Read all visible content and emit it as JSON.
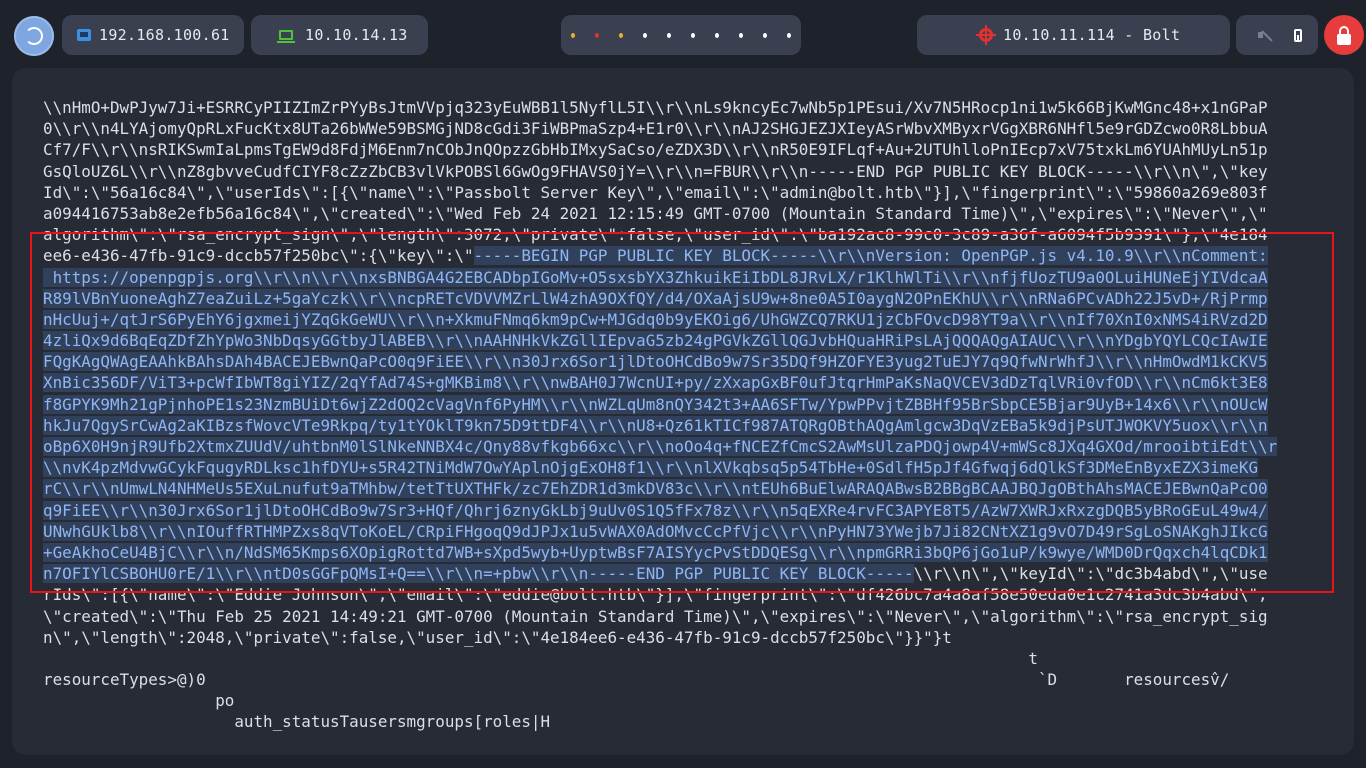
{
  "topbar": {
    "network_ip": "192.168.100.61",
    "vpn_ip": "10.10.14.13",
    "target": "10.10.11.114 - Bolt",
    "workspace_dot_colors": [
      "#e8b030",
      "#e63030",
      "#e8b030",
      "#ffffff",
      "#ffffff",
      "#ffffff",
      "#ffffff",
      "#ffffff",
      "#ffffff",
      "#ffffff"
    ],
    "icons": {
      "logo": "debian-swirl-icon",
      "network": "network-card-icon",
      "vpn": "laptop-icon",
      "target": "crosshair-icon",
      "mute": "speaker-muted-icon",
      "battery": "battery-icon",
      "lock": "lock-icon"
    }
  },
  "terminal": {
    "lines": [
      {
        "pre": "\\\\nHmO+DwPJyw7Ji+ESRRCyPIIZImZrPYyBsJtmVVpjq323yEuWBB1l5NyflL5I\\\\r\\\\nLs9kncyEc7wNb5p1PEsui/Xv7N5HRocp1ni1w5k66BjKwMGnc48+x1nGPaP",
        "sel": "",
        "post": ""
      },
      {
        "pre": "0\\\\r\\\\n4LYAjomyQpRLxFucKtx8UTa26bWWe59BSMGjND8cGdi3FiWBPmaSzp4+E1r0\\\\r\\\\nAJ2SHGJEZJXIeyASrWbvXMByxrVGgXBR6NHfl5e9rGDZcwo0R8LbbuA",
        "sel": "",
        "post": ""
      },
      {
        "pre": "Cf7/F\\\\r\\\\nsRIKSwmIaLpmsTgEW9d8FdjM6Enm7nCObJnQOpzzGbHbIMxySaCso/eZDX3D\\\\r\\\\nR50E9IFLqf+Au+2UTUhlloPnIEcp7xV75txkLm6YUAhMUyLn51p",
        "sel": "",
        "post": ""
      },
      {
        "pre": "GsQloUZ6L\\\\r\\\\nZ8gbvveCudfCIYF8cZzZbCB3vlVkPOBSl6GwOg9FHAVS0jY=\\\\r\\\\n=FBUR\\\\r\\\\n-----END PGP PUBLIC KEY BLOCK-----\\\\r\\\\n\\\",\\\"key",
        "sel": "",
        "post": ""
      },
      {
        "pre": "Id\\\":\\\"56a16c84\\\",\\\"userIds\\\":[{\\\"name\\\":\\\"Passbolt Server Key\\\",\\\"email\\\":\\\"admin@bolt.htb\\\"}],\\\"fingerprint\\\":\\\"59860a269e803f",
        "sel": "",
        "post": ""
      },
      {
        "pre": "a094416753ab8e2efb56a16c84\\\",\\\"created\\\":\\\"Wed Feb 24 2021 12:15:49 GMT-0700 (Mountain Standard Time)\\\",\\\"expires\\\":\\\"Never\\\",\\\"",
        "sel": "",
        "post": ""
      },
      {
        "pre": "algorithm\\\":\\\"rsa_encrypt_sign\\\",\\\"length\\\":3072,\\\"private\\\":false,\\\"user_id\\\":\\\"ba192ac8-99c0-3c89-a36f-a6094f5b9391\\\"},\\\"4e184",
        "sel": "",
        "post": ""
      },
      {
        "pre": "ee6-e436-47fb-91c9-dccb57f250bc\\\":{\\\"key\\\":\\\"",
        "sel": "-----BEGIN PGP PUBLIC KEY BLOCK-----\\\\r\\\\nVersion: OpenPGP.js v4.10.9\\\\r\\\\nComment:",
        "post": ""
      },
      {
        "pre": "",
        "sel": " https://openpgpjs.org\\\\r\\\\n\\\\r\\\\nxsBNBGA4G2EBCADbpIGoMv+O5sxsbYX3ZhkuikEiIbDL8JRvLX/r1KlhWlTi\\\\r\\\\nfjfUozTU9a0OLuiHUNeEjYIVdcaA",
        "post": ""
      },
      {
        "pre": "",
        "sel": "R89lVBnYuoneAghZ7eaZuiLz+5gaYczk\\\\r\\\\ncpRETcVDVVMZrLlW4zhA9OXfQY/d4/OXaAjsU9w+8ne0A5I0aygN2OPnEKhU\\\\r\\\\nRNa6PCvADh22J5vD+/RjPrmp",
        "post": ""
      },
      {
        "pre": "",
        "sel": "nHcUuj+/qtJrS6PyEhY6jgxmeijYZqGkGeWU\\\\r\\\\n+XkmuFNmq6km9pCw+MJGdq0b9yEKOig6/UhGWZCQ7RKU1jzCbFOvcD98YT9a\\\\r\\\\nIf70XnI0xNMS4iRVzd2D",
        "post": ""
      },
      {
        "pre": "",
        "sel": "4zliQx9d6BqEqZDfZhYpWo3NbDqsyGGtbyJlABEB\\\\r\\\\nAAHNHkVkZGllIEpvaG5zb24gPGVkZGllQGJvbHQuaHRiPsLAjQQQAQgAIAUC\\\\r\\\\nYDgbYQYLCQcIAwIE",
        "post": ""
      },
      {
        "pre": "",
        "sel": "FQgKAgQWAgEAAhkBAhsDAh4BACEJEBwnQaPcO0q9FiEE\\\\r\\\\n30Jrx6Sor1jlDtoOHCdBo9w7Sr35DQf9HZOFYE3yug2TuEJY7q9QfwNrWhfJ\\\\r\\\\nHmOwdM1kCKV5",
        "post": ""
      },
      {
        "pre": "",
        "sel": "XnBic356DF/ViT3+pcWfIbWT8giYIZ/2qYfAd74S+gMKBim8\\\\r\\\\nwBAH0J7WcnUI+py/zXxapGxBF0ufJtqrHmPaKsNaQVCEV3dDzTqlVRi0vfOD\\\\r\\\\nCm6kt3E8",
        "post": ""
      },
      {
        "pre": "",
        "sel": "f8GPYK9Mh21gPjnhoPE1s23NzmBUiDt6wjZ2dOQ2cVagVnf6PyHM\\\\r\\\\nWZLqUm8nQY342t3+AA6SFTw/YpwPPvjtZBBHf95BrSbpCE5Bjar9UyB+14x6\\\\r\\\\nOUcW",
        "post": ""
      },
      {
        "pre": "",
        "sel": "hkJu7QgySrCwAg2aKIBzsfWovcVTe9Rkpq/ty1tYOklT9kn75D9ttDF4\\\\r\\\\nU8+Qz61kTICf987ATQRgOBthAQgAmlgcw3DqVzEBa5k9djPsUTJWOKVY5uox\\\\r\\\\n",
        "post": ""
      },
      {
        "pre": "",
        "sel": "oBp6X0H9njR9Ufb2XtmxZUUdV/uhtbnM0lSlNkeNNBX4c/Qny88vfkgb66xc\\\\r\\\\noOo4q+fNCEZfCmcS2AwMsUlzaPDQjowp4V+mWSc8JXq4GXOd/mrooibtiEdt\\\\r",
        "post": ""
      },
      {
        "pre": "",
        "sel": "\\\\nvK4pzMdvwGCykFqugyRDLksc1hfDYU+s5R42TNiMdW7OwYAplnOjgExOH8f1\\\\r\\\\nlXVkqbsq5p54TbHe+0SdlfH5pJf4Gfwqj6dQlkSf3DMeEnByxEZX3imeKG",
        "post": ""
      },
      {
        "pre": "",
        "sel": "rC\\\\r\\\\nUmwLN4NHMeUs5EXuLnufut9aTMhbw/tetTtUXTHFk/zc7EhZDR1d3mkDV83c\\\\r\\\\ntEUh6BuElwARAQABwsB2BBgBCAAJBQJgOBthAhsMACEJEBwnQaPcO0",
        "post": ""
      },
      {
        "pre": "",
        "sel": "q9FiEE\\\\r\\\\n30Jrx6Sor1jlDtoOHCdBo9w7Sr3+HQf/Qhrj6znyGkLbj9uUv0S1Q5fFx78z\\\\r\\\\n5qEXRe4rvFC3APYE8T5/AzW7XWRJxRxzgDQB5yBRoGEuL49w4/",
        "post": ""
      },
      {
        "pre": "",
        "sel": "UNwhGUklb8\\\\r\\\\nIOuffRTHMPZxs8qVToKoEL/CRpiFHgoqQ9dJPJx1u5vWAX0AdOMvcCcPfVjc\\\\r\\\\nPyHN73YWejb7Ji82CNtXZ1g9vO7D49rSgLoSNAKghJIkcG",
        "post": ""
      },
      {
        "pre": "",
        "sel": "+GeAkhoCeU4BjC\\\\r\\\\n/NdSM65Kmps6XOpigRottd7WB+sXpd5wyb+UyptwBsF7AISYycPvStDDQESg\\\\r\\\\npmGRRi3bQP6jGo1uP/k9wye/WMD0DrQqxch4lqCDk1",
        "post": ""
      },
      {
        "pre": "",
        "sel": "n7OFIYlCSBOHU0rE/1\\\\r\\\\ntD0sGGFpQMsI+Q==\\\\r\\\\n=+pbw\\\\r\\\\n-----END PGP PUBLIC KEY BLOCK-----",
        "post": "\\\\r\\\\n\\\",\\\"keyId\\\":\\\"dc3b4abd\\\",\\\"use"
      },
      {
        "pre": "rIds\\\":[{\\\"name\\\":\\\"Eddie Johnson\\\",\\\"email\\\":\\\"eddie@bolt.htb\\\"}],\\\"fingerprint\\\":\\\"df426bc7a4a8af58e50eda0e1c2741a3dc3b4abd\\\",",
        "sel": "",
        "post": ""
      },
      {
        "pre": "\\\"created\\\":\\\"Thu Feb 25 2021 14:49:21 GMT-0700 (Mountain Standard Time)\\\",\\\"expires\\\":\\\"Never\\\",\\\"algorithm\\\":\\\"rsa_encrypt_sig",
        "sel": "",
        "post": ""
      },
      {
        "pre": "n\\\",\\\"length\\\":2048,\\\"private\\\":false,\\\"user_id\\\":\\\"4e184ee6-e436-47fb-91c9-dccb57f250bc\\\"}}\"}t",
        "sel": "",
        "post": ""
      },
      {
        "pre": "                                                                                                       t",
        "sel": "",
        "post": ""
      },
      {
        "pre": "resourceTypes>@)0                                                                                       `D       resourcesv̂/",
        "sel": "",
        "post": ""
      },
      {
        "pre": "                  po",
        "sel": "",
        "post": ""
      },
      {
        "pre": "                    auth_statusTausersmgroups[roles|H",
        "sel": "",
        "post": ""
      }
    ]
  }
}
